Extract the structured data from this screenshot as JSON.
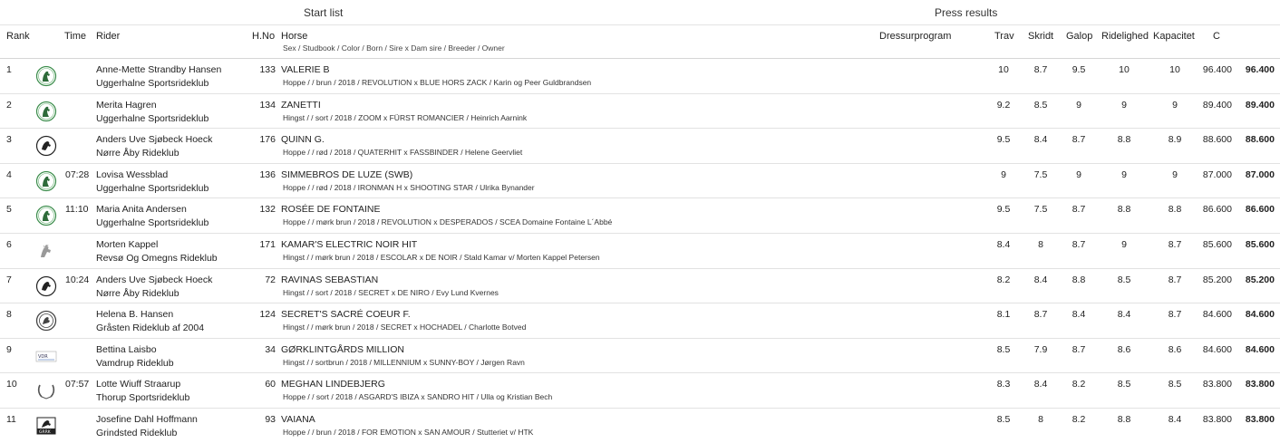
{
  "header": {
    "start_list": "Start list",
    "press_results": "Press results"
  },
  "columns": {
    "rank": "Rank",
    "time": "Time",
    "rider": "Rider",
    "hno": "H.No",
    "horse": "Horse",
    "horse_sub": "Sex / Studbook / Color / Born / Sire x Dam sire / Breeder / Owner",
    "program": "Dressurprogram",
    "trav": "Trav",
    "skridt": "Skridt",
    "galop": "Galop",
    "ridelighed": "Ridelighed",
    "kapacitet": "Kapacitet",
    "c": "C"
  },
  "rows": [
    {
      "rank": "1",
      "time": "",
      "logo": "uggerhalne-logo",
      "rider": "Anne-Mette Strandby Hansen",
      "club": "Uggerhalne Sportsrideklub",
      "hno": "133",
      "horse": "VALERIE B",
      "info": "Hoppe / / brun / 2018 / REVOLUTION x BLUE HORS ZACK / Karin og Peer Guldbrandsen",
      "trav": "10",
      "skridt": "8.7",
      "galop": "9.5",
      "ridelighed": "10",
      "kapacitet": "10",
      "pct": "96.400",
      "total": "96.400"
    },
    {
      "rank": "2",
      "time": "",
      "logo": "uggerhalne-logo",
      "rider": "Merita Hagren",
      "club": "Uggerhalne Sportsrideklub",
      "hno": "134",
      "horse": "ZANETTI",
      "info": "Hingst / / sort / 2018 / ZOOM x FÜRST ROMANCIER / Heinrich Aarnink",
      "trav": "9.2",
      "skridt": "8.5",
      "galop": "9",
      "ridelighed": "9",
      "kapacitet": "9",
      "pct": "89.400",
      "total": "89.400"
    },
    {
      "rank": "3",
      "time": "",
      "logo": "norre-aaby-logo",
      "rider": "Anders Uve Sjøbeck Hoeck",
      "club": "Nørre Åby Rideklub",
      "hno": "176",
      "horse": "QUINN G.",
      "info": "Hoppe / / rød / 2018 / QUATERHIT x FASSBINDER / Helene Geervliet",
      "trav": "9.5",
      "skridt": "8.4",
      "galop": "8.7",
      "ridelighed": "8.8",
      "kapacitet": "8.9",
      "pct": "88.600",
      "total": "88.600"
    },
    {
      "rank": "4",
      "time": "07:28",
      "logo": "uggerhalne-logo",
      "rider": "Lovisa Wessblad",
      "club": "Uggerhalne Sportsrideklub",
      "hno": "136",
      "horse": "SIMMEBROS DE LUZE (SWB)",
      "info": "Hoppe / / rød / 2018 / IRONMAN H x SHOOTING STAR / Ulrika Bynander",
      "trav": "9",
      "skridt": "7.5",
      "galop": "9",
      "ridelighed": "9",
      "kapacitet": "9",
      "pct": "87.000",
      "total": "87.000"
    },
    {
      "rank": "5",
      "time": "11:10",
      "logo": "uggerhalne-logo",
      "rider": "Maria Anita Andersen",
      "club": "Uggerhalne Sportsrideklub",
      "hno": "132",
      "horse": "ROSÉE DE FONTAINE",
      "info": "Hoppe / / mørk brun / 2018 / REVOLUTION x DESPERADOS / SCEA Domaine Fontaine L´Abbé",
      "trav": "9.5",
      "skridt": "7.5",
      "galop": "8.7",
      "ridelighed": "8.8",
      "kapacitet": "8.8",
      "pct": "86.600",
      "total": "86.600"
    },
    {
      "rank": "6",
      "time": "",
      "logo": "revso-logo",
      "rider": "Morten Kappel",
      "club": "Revsø Og Omegns Rideklub",
      "hno": "171",
      "horse": "KAMAR'S ELECTRIC NOIR HIT",
      "info": "Hingst / / mørk brun / 2018 / ESCOLAR x DE NOIR / Stald Kamar v/ Morten Kappel Petersen",
      "trav": "8.4",
      "skridt": "8",
      "galop": "8.7",
      "ridelighed": "9",
      "kapacitet": "8.7",
      "pct": "85.600",
      "total": "85.600"
    },
    {
      "rank": "7",
      "time": "10:24",
      "logo": "norre-aaby-logo",
      "rider": "Anders Uve Sjøbeck Hoeck",
      "club": "Nørre Åby Rideklub",
      "hno": "72",
      "horse": "RAVINAS SEBASTIAN",
      "info": "Hingst / / sort / 2018 / SECRET x DE NIRO / Evy Lund Kvernes",
      "trav": "8.2",
      "skridt": "8.4",
      "galop": "8.8",
      "ridelighed": "8.5",
      "kapacitet": "8.7",
      "pct": "85.200",
      "total": "85.200"
    },
    {
      "rank": "8",
      "time": "",
      "logo": "grasten-logo",
      "rider": "Helena B. Hansen",
      "club": "Gråsten Rideklub af 2004",
      "hno": "124",
      "horse": "SECRET'S SACRÉ COEUR F.",
      "info": "Hingst / / mørk brun / 2018 / SECRET x HOCHADEL / Charlotte Botved",
      "trav": "8.1",
      "skridt": "8.7",
      "galop": "8.4",
      "ridelighed": "8.4",
      "kapacitet": "8.7",
      "pct": "84.600",
      "total": "84.600"
    },
    {
      "rank": "9",
      "time": "",
      "logo": "vamdrup-logo",
      "rider": "Bettina Laisbo",
      "club": "Vamdrup Rideklub",
      "hno": "34",
      "horse": "GØRKLINTGÅRDS MILLION",
      "info": "Hingst / / sortbrun / 2018 / MILLENNIUM x SUNNY-BOY / Jørgen Ravn",
      "trav": "8.5",
      "skridt": "7.9",
      "galop": "8.7",
      "ridelighed": "8.6",
      "kapacitet": "8.6",
      "pct": "84.600",
      "total": "84.600"
    },
    {
      "rank": "10",
      "time": "07:57",
      "logo": "thorup-logo",
      "rider": "Lotte Wiuff Straarup",
      "club": "Thorup Sportsrideklub",
      "hno": "60",
      "horse": "MEGHAN LINDEBJERG",
      "info": "Hoppe / / sort / 2018 / ASGARD'S IBIZA x SANDRO HIT / Ulla og Kristian Bech",
      "trav": "8.3",
      "skridt": "8.4",
      "galop": "8.2",
      "ridelighed": "8.5",
      "kapacitet": "8.5",
      "pct": "83.800",
      "total": "83.800"
    },
    {
      "rank": "11",
      "time": "",
      "logo": "grindsted-logo",
      "rider": "Josefine Dahl Hoffmann",
      "club": "Grindsted Rideklub",
      "hno": "93",
      "horse": "VAIANA",
      "info": "Hoppe / / brun / 2018 / FOR EMOTION x SAN AMOUR / Stutteriet v/ HTK",
      "trav": "8.5",
      "skridt": "8",
      "galop": "8.2",
      "ridelighed": "8.8",
      "kapacitet": "8.4",
      "pct": "83.800",
      "total": "83.800"
    }
  ]
}
